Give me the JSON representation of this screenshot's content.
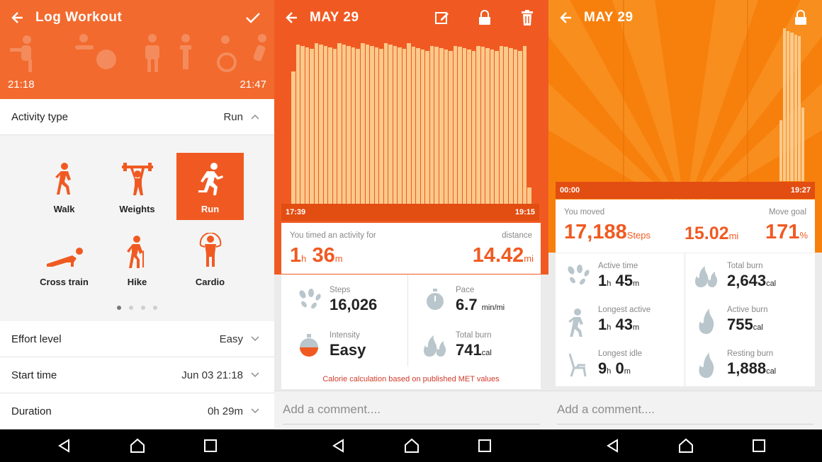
{
  "screen1": {
    "title": "Log Workout",
    "start_time": "21:18",
    "end_time": "21:47",
    "activity_type": {
      "label": "Activity type",
      "value": "Run"
    },
    "activities": [
      {
        "label": "Walk",
        "icon": "walk-icon"
      },
      {
        "label": "Weights",
        "icon": "weights-icon"
      },
      {
        "label": "Run",
        "icon": "run-icon",
        "selected": true
      },
      {
        "label": "Cross train",
        "icon": "cross-train-icon"
      },
      {
        "label": "Hike",
        "icon": "hike-icon"
      },
      {
        "label": "Cardio",
        "icon": "cardio-icon"
      }
    ],
    "page_count": 4,
    "page_current": 1,
    "effort": {
      "label": "Effort level",
      "value": "Easy"
    },
    "start": {
      "label": "Start time",
      "value": "Jun 03 21:18"
    },
    "duration": {
      "label": "Duration",
      "value": "0h 29m"
    }
  },
  "screen2": {
    "title": "MAY 29",
    "chart_start": "17:39",
    "chart_end": "19:15",
    "summary_label": "You timed an activity for",
    "distance_label": "distance",
    "duration_h": "1",
    "duration_m": "36",
    "unit_h": "h",
    "unit_m": "m",
    "distance": "14.42",
    "distance_unit": "mi",
    "steps": {
      "label": "Steps",
      "value": "16,026"
    },
    "pace": {
      "label": "Pace",
      "value": "6.7",
      "unit": "min/mi"
    },
    "intensity": {
      "label": "Intensity",
      "value": "Easy"
    },
    "total_burn": {
      "label": "Total burn",
      "value": "741",
      "unit": "cal"
    },
    "note": "Calorie calculation based on published MET values",
    "comment_placeholder": "Add a comment...."
  },
  "screen3": {
    "title": "MAY 29",
    "chart_start": "00:00",
    "chart_end": "19:27",
    "moved_label": "You moved",
    "goal_label": "Move goal",
    "steps": "17,188",
    "steps_unit": "Steps",
    "distance": "15.02",
    "distance_unit": "mi",
    "goal_pct": "171",
    "pct_unit": "%",
    "active_time": {
      "label": "Active time",
      "h": "1",
      "m": "45"
    },
    "longest_active": {
      "label": "Longest active",
      "h": "1",
      "m": "43"
    },
    "longest_idle": {
      "label": "Longest idle",
      "h": "9",
      "m": "0"
    },
    "unit_h": "h",
    "unit_m": "m",
    "total_burn": {
      "label": "Total burn",
      "value": "2,643",
      "unit": "cal"
    },
    "active_burn": {
      "label": "Active burn",
      "value": "755",
      "unit": "cal"
    },
    "resting_burn": {
      "label": "Resting burn",
      "value": "1,888",
      "unit": "cal"
    },
    "comment_placeholder": "Add a comment...."
  },
  "colors": {
    "accent": "#f05a22",
    "bar": "#fbc98a",
    "sun": "#f7800c"
  }
}
